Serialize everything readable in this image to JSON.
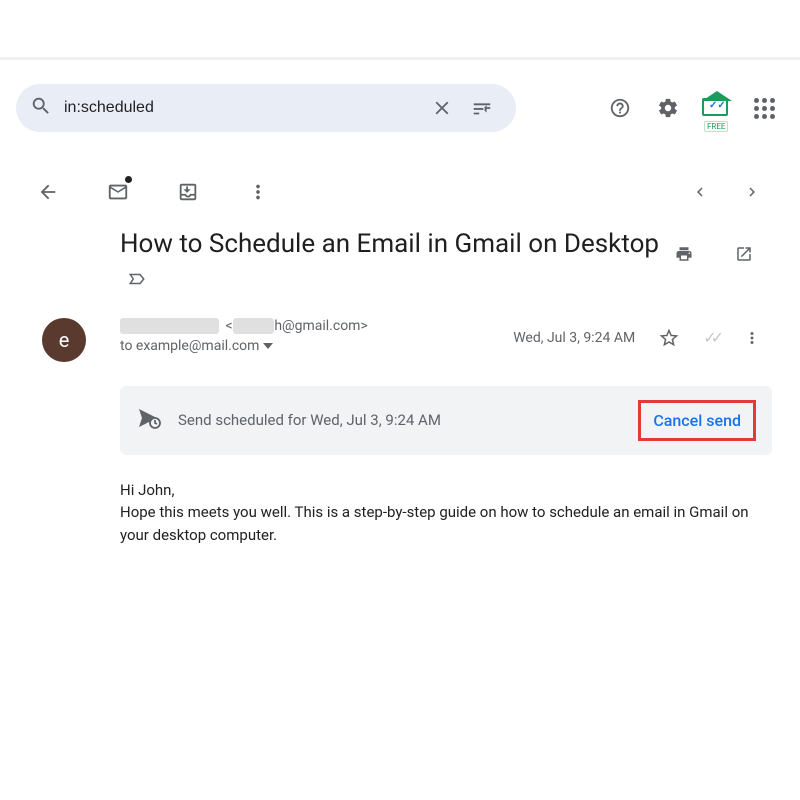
{
  "search": {
    "query": "in:scheduled"
  },
  "email": {
    "subject": "How to Schedule an Email in Gmail on Desktop",
    "sender_email_visible": "h@gmail.com",
    "to": "to example@mail.com",
    "date": "Wed, Jul 3, 9:24 AM",
    "avatar_initial": "e"
  },
  "scheduled": {
    "text": "Send scheduled for Wed, Jul 3, 9:24 AM",
    "cancel_label": "Cancel send"
  },
  "body": {
    "greeting": "Hi John,",
    "paragraph": "Hope this meets you well. This is a step-by-step guide on how to schedule an email in Gmail on your desktop computer."
  },
  "ext": {
    "free": "FREE"
  }
}
